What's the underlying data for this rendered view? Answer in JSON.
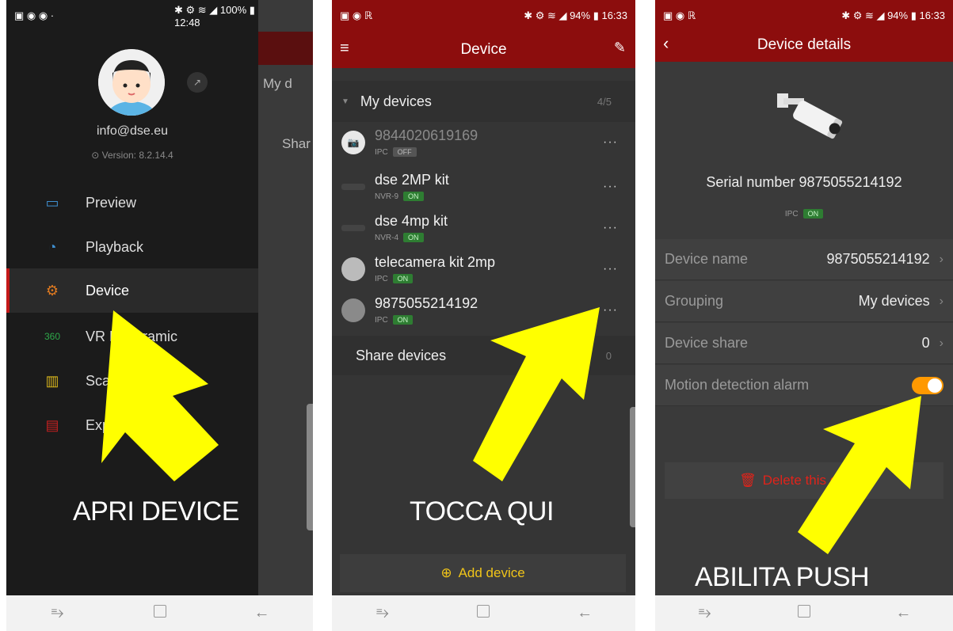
{
  "phone1": {
    "status": {
      "left_icons": "▣ ◉ ◉ ·",
      "right": "✱ ⚙ ≋ ◢ 100% ▮ 12:48"
    },
    "email": "info@dse.eu",
    "version": "Version: 8.2.14.4",
    "menu": [
      {
        "icon": "camera-icon",
        "label": "Preview"
      },
      {
        "icon": "playback-icon",
        "label": "Playback"
      },
      {
        "icon": "gear-icon",
        "label": "Device"
      },
      {
        "icon": "panoramic-icon",
        "label": "VR Panoramic"
      },
      {
        "icon": "barcode-icon",
        "label": "Scan"
      },
      {
        "icon": "experience-icon",
        "label": "Experience"
      }
    ],
    "behind_items": [
      "My d",
      "Shar"
    ],
    "caption": "APRI DEVICE"
  },
  "phone2": {
    "status": {
      "left_icons": "▣ ◉ ℝ",
      "right": "✱ ⚙ ≋ ◢ 94% ▮ 16:33"
    },
    "title": "Device",
    "group_title": "My devices",
    "group_count": "4/5",
    "devices": [
      {
        "name": "9844020619169",
        "type": "IPC",
        "status": "OFF"
      },
      {
        "name": "dse 2MP kit",
        "type": "NVR-9",
        "status": "ON"
      },
      {
        "name": "dse 4mp kit",
        "type": "NVR-4",
        "status": "ON"
      },
      {
        "name": "telecamera kit 2mp",
        "type": "IPC",
        "status": "ON"
      },
      {
        "name": "9875055214192",
        "type": "IPC",
        "status": "ON"
      }
    ],
    "share_label": "Share devices",
    "share_count": "0",
    "add_device": "Add device",
    "caption": "TOCCA QUI"
  },
  "phone3": {
    "status": {
      "left_icons": "▣ ◉ ℝ",
      "right": "✱ ⚙ ≋ ◢ 94% ▮ 16:33"
    },
    "title": "Device details",
    "serial": "Serial number 9875055214192",
    "type": "IPC",
    "status_tag": "ON",
    "rows": [
      {
        "label": "Device name",
        "value": "9875055214192"
      },
      {
        "label": "Grouping",
        "value": "My devices"
      },
      {
        "label": "Device share",
        "value": "0"
      },
      {
        "label": "Motion detection alarm",
        "value": ""
      }
    ],
    "motion_alarm_enabled": true,
    "delete_label": "Delete this device",
    "caption": "ABILITA PUSH"
  },
  "colors": {
    "red_header": "#8c0d0d",
    "accent": "#ff9900",
    "arrow": "#ffff00",
    "on_tag": "#2e7d32"
  }
}
